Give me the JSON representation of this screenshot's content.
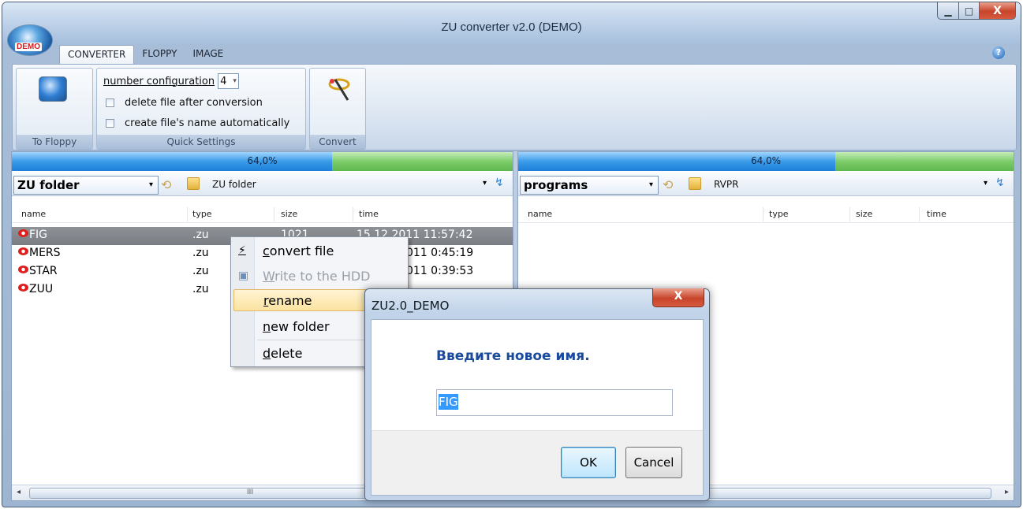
{
  "window": {
    "title": "ZU converter v2.0 (DEMO)",
    "badge": "DEMO",
    "min_glyph": "▁",
    "max_glyph": "□",
    "close_glyph": "X"
  },
  "tabs": [
    {
      "label": "CONVERTER"
    },
    {
      "label": "FLOPPY"
    },
    {
      "label": "IMAGE"
    }
  ],
  "help_glyph": "?",
  "ribbon": {
    "to_floppy": {
      "label": "To Floppy"
    },
    "quick_settings": {
      "label": "Quick Settings",
      "number_configuration_label": "number configuration",
      "number_configuration_value": "4",
      "delete_after_label": "delete file after conversion",
      "auto_name_label": "create file's name automatically"
    },
    "convert": {
      "label": "Convert"
    }
  },
  "left_panel": {
    "usage_text": "64,0%",
    "usage_fraction": 0.64,
    "drive": "ZU folder",
    "path": "ZU folder",
    "columns": {
      "name": "name",
      "type": "type",
      "size": "size",
      "time": "time"
    },
    "files": [
      {
        "name": "FIG",
        "type": ".zu",
        "size": "1021",
        "time": "15.12.2011 11:57:42"
      },
      {
        "name": "MERS",
        "type": ".zu",
        "size": "",
        "time": "011 0:45:19"
      },
      {
        "name": "STAR",
        "type": ".zu",
        "size": "",
        "time": "011 0:39:53"
      },
      {
        "name": "ZUU",
        "type": ".zu",
        "size": "",
        "time": ""
      }
    ],
    "scroll_grip": "III"
  },
  "right_panel": {
    "usage_text": "64,0%",
    "usage_fraction": 0.64,
    "drive": "programs",
    "path": "RVPR",
    "columns": {
      "name": "name",
      "type": "type",
      "size": "size",
      "time": "time"
    }
  },
  "context_menu": {
    "items": [
      {
        "label": "convert file",
        "disabled": false
      },
      {
        "label": "Write to the HDD",
        "disabled": true
      },
      {
        "label": "rename",
        "disabled": false
      },
      {
        "label": "new folder",
        "disabled": false
      },
      {
        "label": "delete",
        "disabled": false
      }
    ]
  },
  "dialog": {
    "title": "ZU2.0_DEMO",
    "close_glyph": "X",
    "prompt": "Введите новое имя.",
    "input_value": "FIG",
    "ok_label": "OK",
    "cancel_label": "Cancel"
  },
  "glyphs": {
    "dropdown": "▾",
    "back": "⟲",
    "refresh": "↯",
    "scroll_left": "◂",
    "scroll_right": "▸",
    "wand": "⚡",
    "disk": "▣"
  },
  "colors": {
    "progress_used": "#3a9be8",
    "progress_free": "#7dcc6a",
    "selected_row": "#7e8288",
    "menu_highlight": "#fbe3a0",
    "prompt_text": "#1a4a9e",
    "file_icon": "#e01c1c"
  },
  "icons": {
    "app": "app-logo-icon",
    "floppy": "floppy-icon",
    "convert": "magic-wand-icon",
    "folder": "folder-icon",
    "file": "zu-file-icon"
  }
}
